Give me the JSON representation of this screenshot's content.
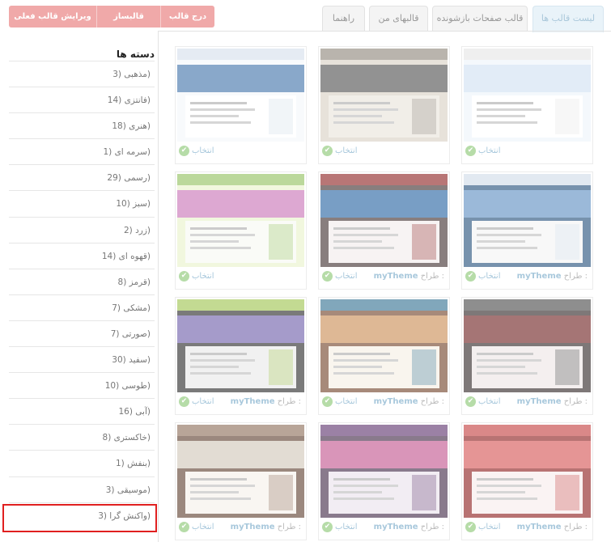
{
  "top_buttons": [
    {
      "label": "ویرایش قالب فعلی"
    },
    {
      "label": "قالبساز"
    },
    {
      "label": "درج قالب"
    }
  ],
  "tabs": [
    {
      "label": "راهنما"
    },
    {
      "label": "قالبهای من"
    },
    {
      "label": "قالب صفحات بازشونده"
    },
    {
      "label": "لیست قالب ها",
      "active": true
    }
  ],
  "sidebar": {
    "title": "دسته ها",
    "categories": [
      {
        "label": "(مذهبی (3"
      },
      {
        "label": "(فانتزی (14"
      },
      {
        "label": "(هنری (18"
      },
      {
        "label": "(سرمه ای (1"
      },
      {
        "label": "(رسمی (29"
      },
      {
        "label": "(سبز (10"
      },
      {
        "label": "(زرد (2"
      },
      {
        "label": "(قهوه ای (14"
      },
      {
        "label": "(قرمز (8"
      },
      {
        "label": "(مشکی (7"
      },
      {
        "label": "(صورتی (7"
      },
      {
        "label": "(سفید (30"
      },
      {
        "label": "(طوسی (10"
      },
      {
        "label": "(آبی (16"
      },
      {
        "label": "(خاکستری (8"
      },
      {
        "label": "(بنفش (1"
      },
      {
        "label": "(موسیقی (3"
      },
      {
        "label": "(واکنش گرا (3"
      }
    ]
  },
  "card_labels": {
    "select": "انتخاب",
    "designer_prefix": "طراح :",
    "designer_name": "myTheme"
  },
  "templates": [
    {
      "show_designer": false,
      "theme": "blue-plain"
    },
    {
      "show_designer": false,
      "theme": "grey-brown"
    },
    {
      "show_designer": false,
      "theme": "white-blue"
    },
    {
      "show_designer": true,
      "theme": "blue-frame"
    },
    {
      "show_designer": true,
      "theme": "dark-red"
    },
    {
      "show_designer": false,
      "theme": "pink-green"
    },
    {
      "show_designer": true,
      "theme": "dark-red-2"
    },
    {
      "show_designer": true,
      "theme": "wood"
    },
    {
      "show_designer": true,
      "theme": "car-purple"
    },
    {
      "show_designer": true,
      "theme": "red-hearts"
    },
    {
      "show_designer": true,
      "theme": "night-purple"
    },
    {
      "show_designer": true,
      "theme": "brown-desk"
    }
  ],
  "colors": {
    "accent_button": "#f0a9a9",
    "highlight": "#e02020",
    "select_check": "#b6dca8",
    "link": "#a8c8dc"
  }
}
